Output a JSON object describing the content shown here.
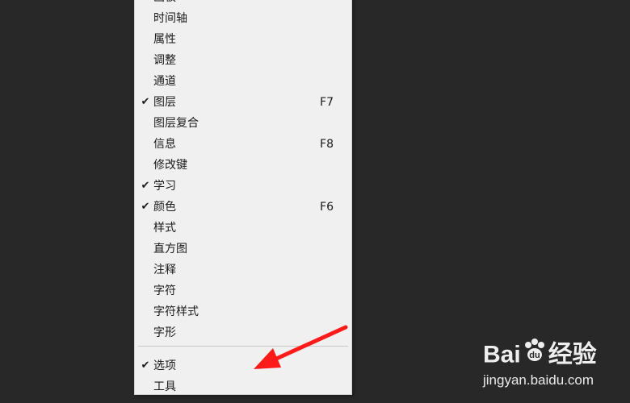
{
  "menu": {
    "items": [
      {
        "label": "画板",
        "checked": false,
        "shortcut": ""
      },
      {
        "label": "时间轴",
        "checked": false,
        "shortcut": ""
      },
      {
        "label": "属性",
        "checked": false,
        "shortcut": ""
      },
      {
        "label": "调整",
        "checked": false,
        "shortcut": ""
      },
      {
        "label": "通道",
        "checked": false,
        "shortcut": ""
      },
      {
        "label": "图层",
        "checked": true,
        "shortcut": "F7"
      },
      {
        "label": "图层复合",
        "checked": false,
        "shortcut": ""
      },
      {
        "label": "信息",
        "checked": false,
        "shortcut": "F8"
      },
      {
        "label": "修改键",
        "checked": false,
        "shortcut": ""
      },
      {
        "label": "学习",
        "checked": true,
        "shortcut": ""
      },
      {
        "label": "颜色",
        "checked": true,
        "shortcut": "F6"
      },
      {
        "label": "样式",
        "checked": false,
        "shortcut": ""
      },
      {
        "label": "直方图",
        "checked": false,
        "shortcut": ""
      },
      {
        "label": "注释",
        "checked": false,
        "shortcut": ""
      },
      {
        "label": "字符",
        "checked": false,
        "shortcut": ""
      },
      {
        "label": "字符样式",
        "checked": false,
        "shortcut": ""
      },
      {
        "label": "字形",
        "checked": false,
        "shortcut": ""
      },
      {
        "label": "选项",
        "checked": true,
        "shortcut": ""
      },
      {
        "label": "工具",
        "checked": false,
        "shortcut": ""
      }
    ],
    "check_glyph": "✔"
  },
  "annotation": {
    "arrow_color": "#ff1a1a",
    "icon": "red-arrow-icon"
  },
  "watermark": {
    "logo_left": "Bai",
    "logo_right": "经验",
    "url": "jingyan.baidu.com"
  }
}
